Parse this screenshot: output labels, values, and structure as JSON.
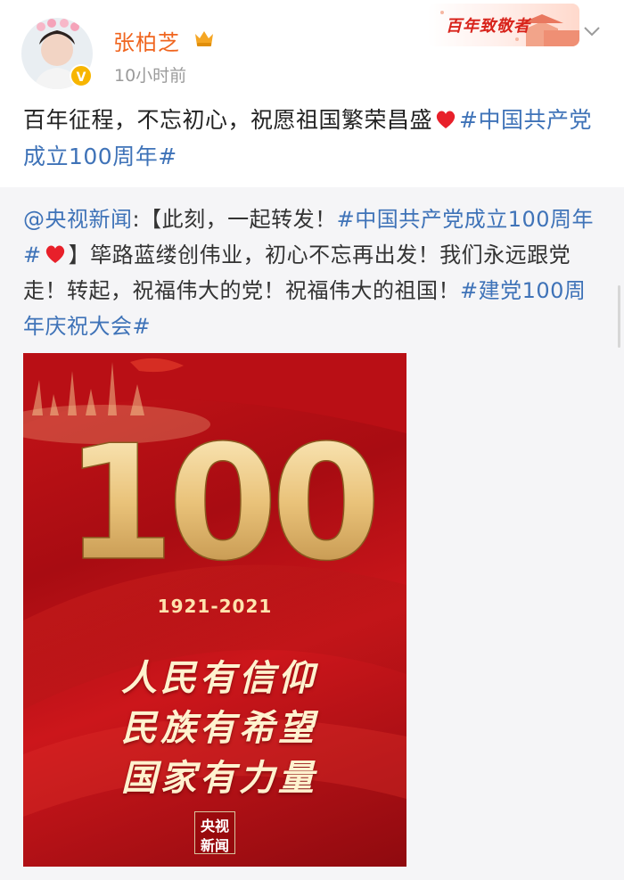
{
  "author": {
    "name": "张柏芝",
    "timestamp": "10小时前"
  },
  "badge": {
    "label": "百年致敬者"
  },
  "post": {
    "text": "百年征程，不忘初心，祝愿祖国繁荣昌盛",
    "topic": "#中国共产党成立100周年#"
  },
  "repost": {
    "source_mention": "@央视新闻",
    "colon": ":",
    "bracket_text": "【此刻，一起转发！",
    "bracket_topic": "#中国共产党成立100周年#",
    "bracket_close": "】",
    "body": "筚路蓝缕创伟业，初心不忘再出发！我们永远跟党走！转起，祝福伟大的党！祝福伟大的祖国！",
    "end_topic": "#建党100周年庆祝大会#"
  },
  "poster": {
    "big_number": "100",
    "years": "1921-2021",
    "slogans": [
      "人民有信仰",
      "民族有希望",
      "国家有力量"
    ],
    "logo_line1": "央视",
    "logo_line2": "新闻"
  },
  "icons": [
    "avatar",
    "verified-icon",
    "vip-crown-icon",
    "chevron-down-icon",
    "heart-emoji-icon"
  ],
  "colors": {
    "username": "#f0651f",
    "link": "#3f73b8",
    "poster_red": "#c71418",
    "gold": "#f3d490"
  }
}
